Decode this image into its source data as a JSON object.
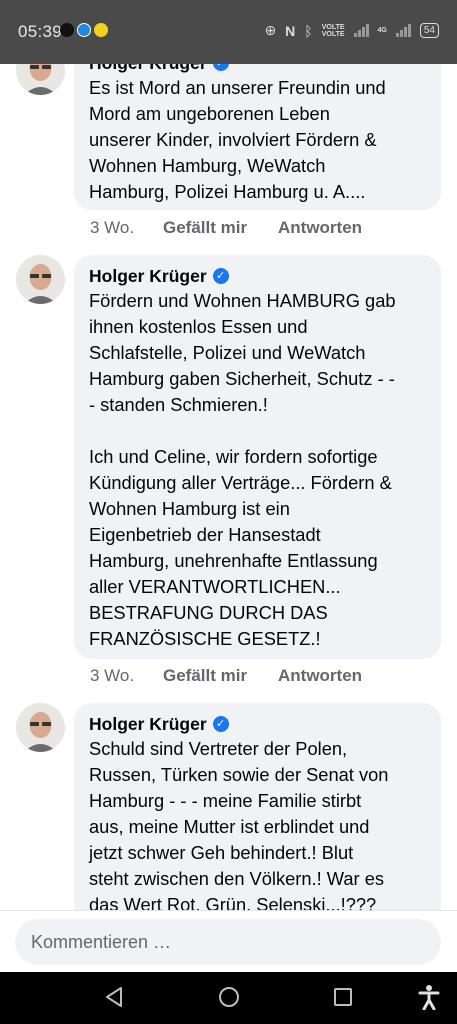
{
  "status_bar": {
    "time": "05:39",
    "net1": "VOLTE",
    "net2": "VOLTE",
    "gen": "4G",
    "battery": "54"
  },
  "comments": [
    {
      "author": "Holger Krüger",
      "text": "Es ist Mord an unserer Freundin und\nMord am ungeborenen Leben\nunserer Kinder, involviert Fördern &\nWohnen Hamburg, WeWatch\nHamburg, Polizei Hamburg u. A....",
      "time": "3 Wo.",
      "like": "Gefällt mir",
      "reply": "Antworten"
    },
    {
      "author": "Holger Krüger",
      "text": "Fördern und Wohnen HAMBURG gab\nihnen kostenlos Essen und\nSchlafstelle, Polizei und WeWatch\nHamburg gaben Sicherheit, Schutz - -\n- standen Schmieren.!\n\nIch und Celine, wir fordern sofortige\nKündigung aller Verträge... Fördern &\nWohnen Hamburg ist ein\nEigenbetrieb der Hansestadt\nHamburg, unehrenhafte Entlassung\naller VERANTWORTLICHEN...\nBESTRAFUNG DURCH DAS\nFRANZÖSISCHE GESETZ.!",
      "time": "3 Wo.",
      "like": "Gefällt mir",
      "reply": "Antworten"
    },
    {
      "author": "Holger Krüger",
      "text": "Schuld sind Vertreter der Polen,\nRussen, Türken sowie der Senat von\nHamburg - - - meine Familie stirbt\naus, meine Mutter ist erblindet und\njetzt schwer Geh behindert.! Blut\nsteht zwischen den Völkern.! War es\ndas Wert Rot, Grün, Selenski...!???"
    }
  ],
  "composer": {
    "placeholder": "Kommentieren …"
  },
  "icons": {
    "verified": "verified-badge-icon",
    "back": "back-triangle-icon",
    "home": "home-circle-icon",
    "recents": "recents-square-icon",
    "accessibility": "accessibility-icon"
  }
}
